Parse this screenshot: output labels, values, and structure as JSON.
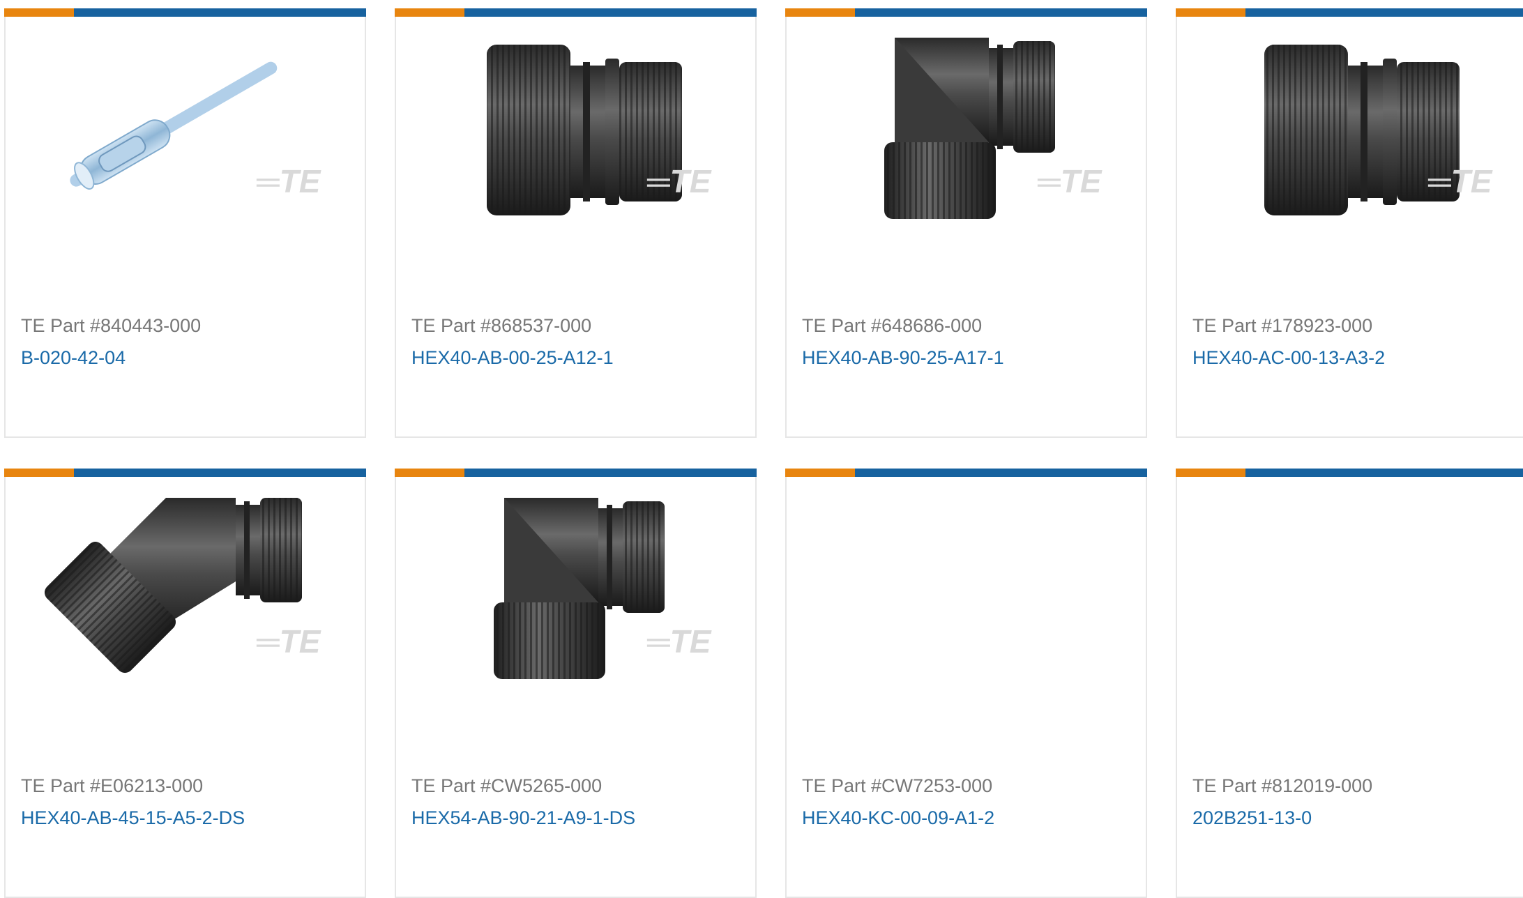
{
  "brand_colors": {
    "accent_orange": "#e8850f",
    "accent_blue": "#17629f",
    "link_blue": "#1a6aa8",
    "text_gray": "#777777"
  },
  "watermark": "TE",
  "products": [
    {
      "part_number": "TE Part #840443-000",
      "name": "B-020-42-04",
      "image": "heat-shrink-sleeve"
    },
    {
      "part_number": "TE Part #868537-000",
      "name": "HEX40-AB-00-25-A12-1",
      "image": "straight-connector"
    },
    {
      "part_number": "TE Part #648686-000",
      "name": "HEX40-AB-90-25-A17-1",
      "image": "right-angle-connector"
    },
    {
      "part_number": "TE Part #178923-000",
      "name": "HEX40-AC-00-13-A3-2",
      "image": "straight-connector"
    },
    {
      "part_number": "TE Part #E06213-000",
      "name": "HEX40-AB-45-15-A5-2-DS",
      "image": "45-degree-connector"
    },
    {
      "part_number": "TE Part #CW5265-000",
      "name": "HEX54-AB-90-21-A9-1-DS",
      "image": "right-angle-connector"
    },
    {
      "part_number": "TE Part #CW7253-000",
      "name": "HEX40-KC-00-09-A1-2",
      "image": "none"
    },
    {
      "part_number": "TE Part #812019-000",
      "name": "202B251-13-0",
      "image": "none"
    }
  ]
}
